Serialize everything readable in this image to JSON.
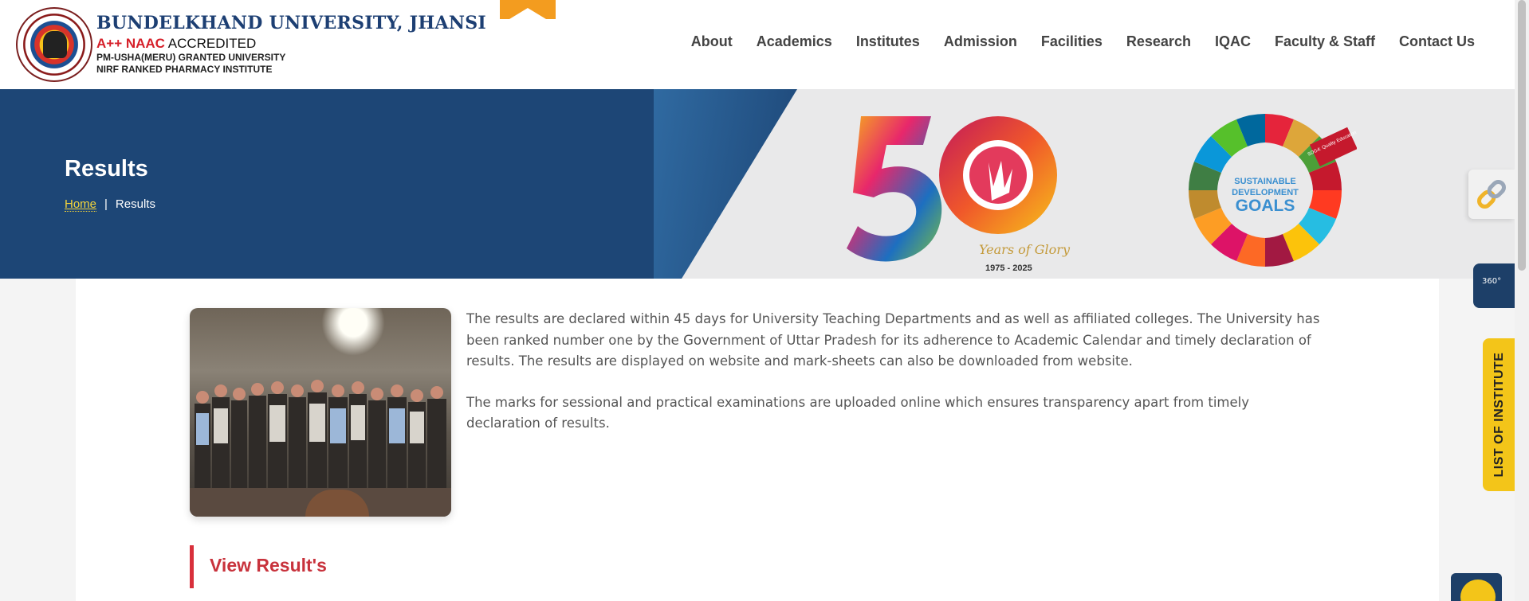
{
  "header": {
    "university": "BUNDELKHAND UNIVERSITY, JHANSI",
    "naac_highlight": "A++ NAAC",
    "naac_rest": " ACCREDITED",
    "line1": "PM-USHA(MERU) GRANTED UNIVERSITY",
    "line2": "NIRF RANKED PHARMACY INSTITUTE"
  },
  "nav": {
    "items": [
      "About",
      "Academics",
      "Institutes",
      "Admission",
      "Facilities",
      "Research",
      "IQAC",
      "Faculty & Staff",
      "Contact Us"
    ]
  },
  "banner": {
    "title": "Results",
    "breadcrumb": {
      "home": "Home",
      "separator": "|",
      "current": "Results"
    },
    "fifty_tagline": "Years of Glory",
    "fifty_years": "1975 - 2025",
    "sdg_text_1": "SUSTAINABLE",
    "sdg_text_2": "DEVELOPMENT",
    "sdg_text_3": "GOALS",
    "sdg_badge": "SDG4: Quality Education"
  },
  "content": {
    "paragraph1": "The results are declared within 45 days for University Teaching Departments and as well as affiliated colleges. The University has been ranked number one by the Government of Uttar Pradesh for its adherence to Academic Calendar and timely declaration of results. The results are displayed on website and mark-sheets can also be downloaded from website.",
    "paragraph2": "The marks for sessional and practical  examinations are uploaded online which ensures transparency apart from timely declaration of results.",
    "view_results_title": "View Result's"
  },
  "side": {
    "v360_label": "360°",
    "list_of_institute": "LIST OF INSTITUTE"
  },
  "colors": {
    "primary_blue": "#1d4676",
    "accent_red": "#d6202a",
    "accent_yellow": "#f3c519",
    "breadcrumb_home": "#f3d43b"
  }
}
